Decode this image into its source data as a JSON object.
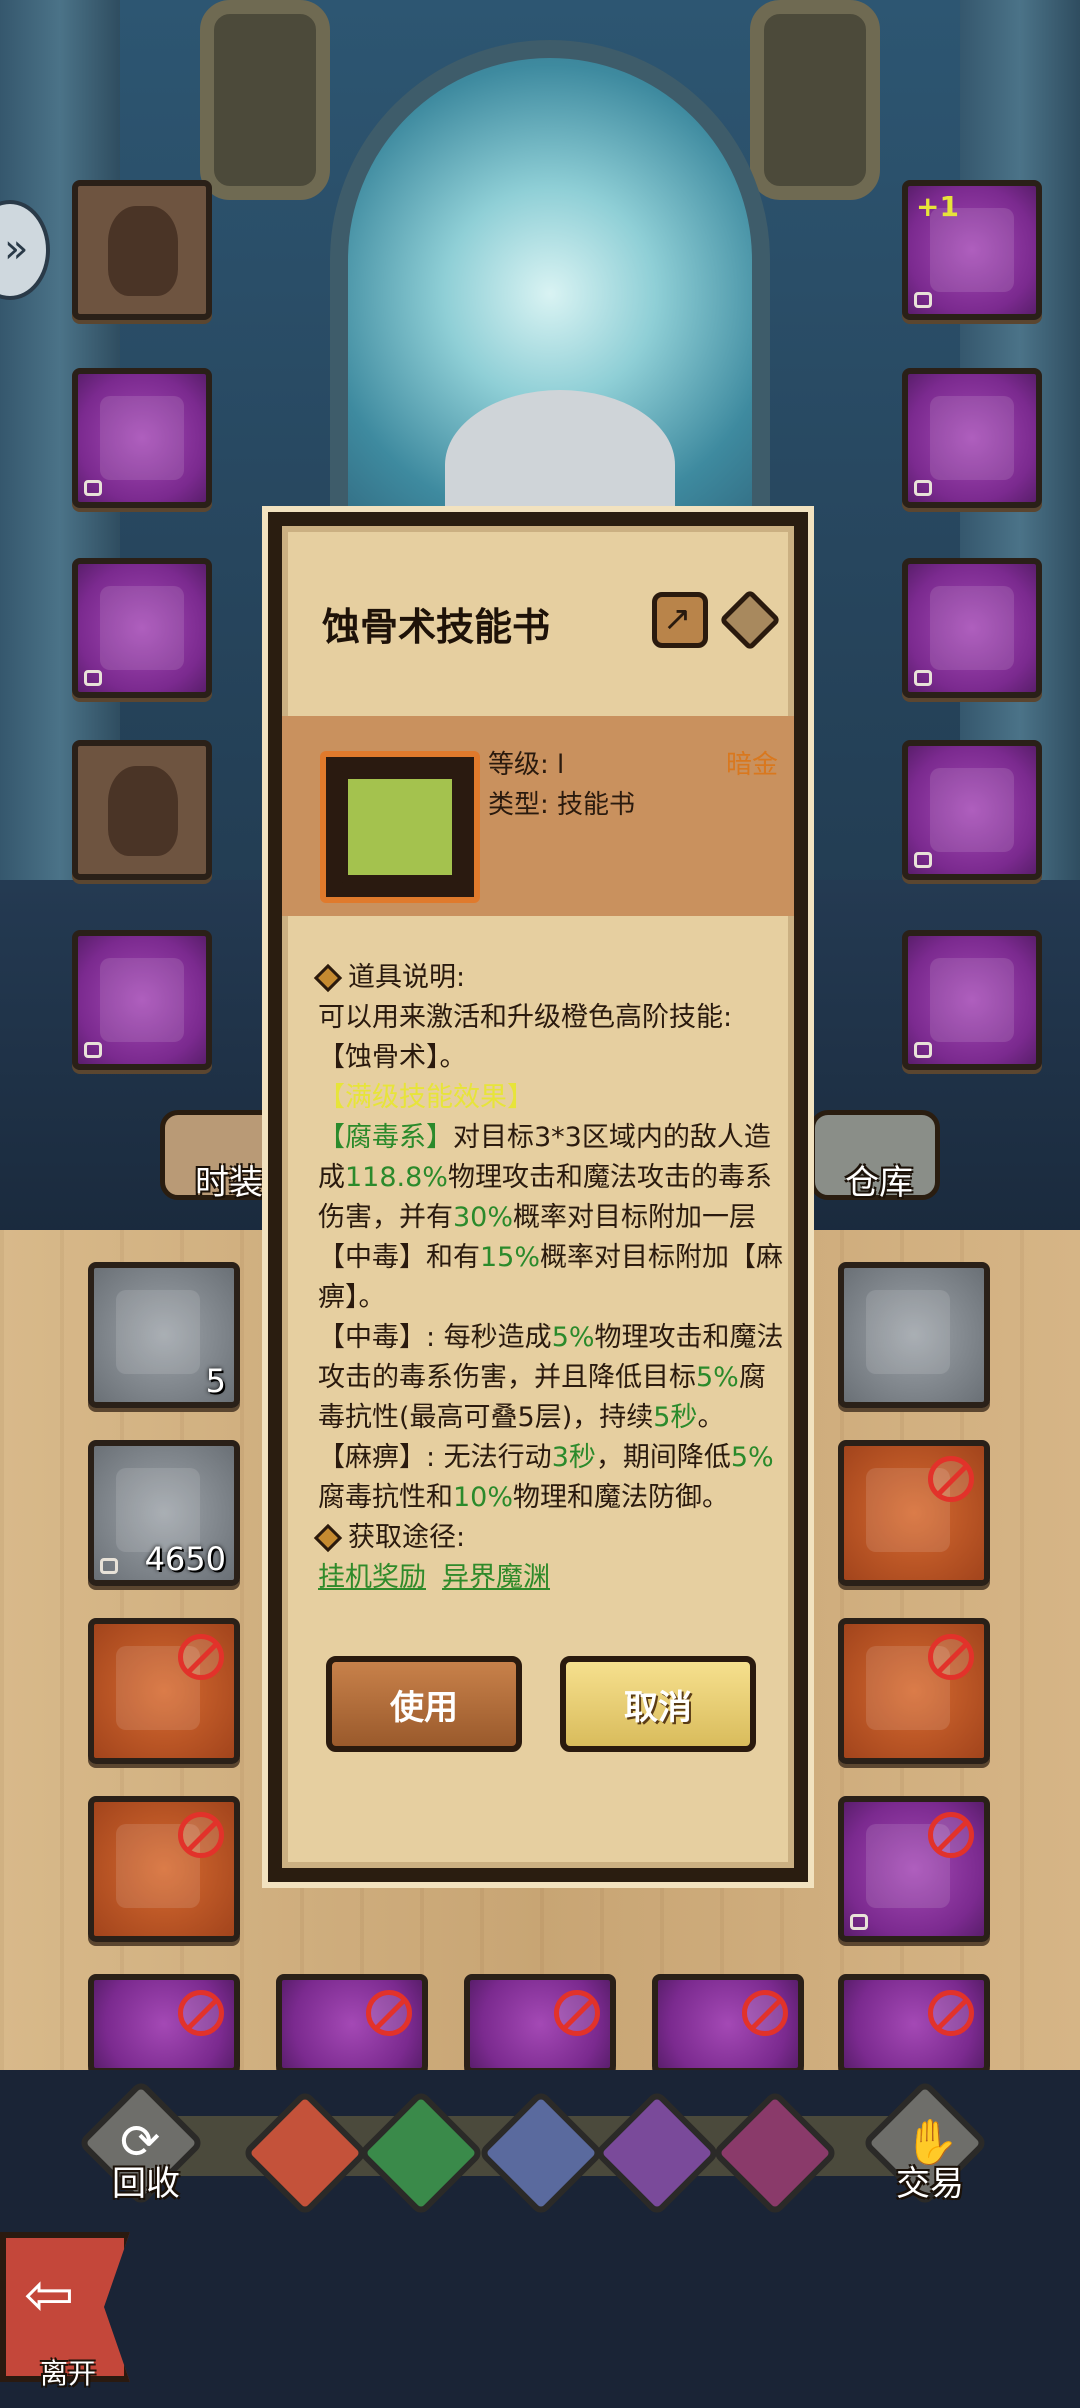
{
  "dialog": {
    "title": "蚀骨术技能书",
    "quality": "暗金",
    "level_label": "等级: l",
    "type_label": "类型: 技能书",
    "section_desc_title": "道具说明:",
    "desc_line1": "可以用来激活和升级橙色高阶技能:",
    "desc_line2": "【蚀骨术】。",
    "max_effect_title": "【满级技能效果】",
    "effect_p1_a": "【腐毒系】",
    "effect_p1_b": "对目标3*3区域内的敌人造成",
    "effect_p1_c": "118.8%",
    "effect_p1_d": "物理攻击和魔法攻击的毒系伤害，并有",
    "effect_p1_e": "30%",
    "effect_p1_f": "概率对目标附加一层【中毒】和有",
    "effect_p1_g": "15%",
    "effect_p1_h": "概率对目标附加【麻痹】。",
    "effect_p2_a": "【中毒】: 每秒造成",
    "effect_p2_b": "5%",
    "effect_p2_c": "物理攻击和魔法攻击的毒系伤害，并且降低目标",
    "effect_p2_d": "5%",
    "effect_p2_e": "腐毒抗性(最高可叠5层)，持续",
    "effect_p2_f": "5秒",
    "effect_p2_g": "。",
    "effect_p3_a": "【麻痹】: 无法行动",
    "effect_p3_b": "3秒",
    "effect_p3_c": "，期间降低",
    "effect_p3_d": "5%",
    "effect_p3_e": "腐毒抗性和",
    "effect_p3_f": "10%",
    "effect_p3_g": "物理和魔法防御。",
    "section_source_title": "获取途径:",
    "source_links": [
      "挂机奖励",
      "异界魔渊"
    ],
    "use_button": "使用",
    "cancel_button": "取消"
  },
  "labels": {
    "fashion": "时装",
    "warehouse": "仓库",
    "recycle": "回收",
    "trade": "交易",
    "leave": "离开",
    "plus_one": "+1"
  },
  "inventory_counts": {
    "first": "5",
    "second": "4650"
  },
  "colors": {
    "green_text": "#2b8a2b",
    "yellow_text": "#e7e43a",
    "quality_orange": "#d9781e"
  }
}
